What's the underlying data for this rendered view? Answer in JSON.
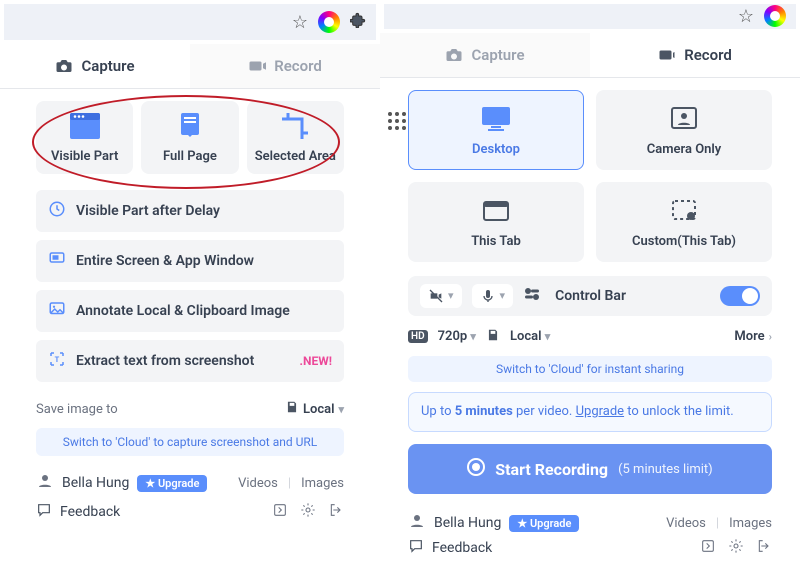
{
  "left": {
    "tabs": {
      "capture": "Capture",
      "record": "Record"
    },
    "cards": {
      "visible_part": "Visible Part",
      "full_page": "Full Page",
      "selected_area": "Selected Area"
    },
    "rows": {
      "delay": "Visible Part after Delay",
      "entire": "Entire Screen & App Window",
      "annotate": "Annotate Local & Clipboard Image",
      "extract": "Extract text from screenshot",
      "new_badge": ".NEW!"
    },
    "save_label": "Save image to",
    "save_target": "Local",
    "cloud_hint": "Switch to 'Cloud' to capture screenshot and URL",
    "user": {
      "name": "Bella Hung",
      "upgrade": "Upgrade",
      "videos": "Videos",
      "images": "Images"
    },
    "feedback": "Feedback"
  },
  "right": {
    "tabs": {
      "capture": "Capture",
      "record": "Record"
    },
    "cards": {
      "desktop": "Desktop",
      "camera": "Camera Only",
      "this_tab": "This Tab",
      "custom": "Custom(This Tab)"
    },
    "control_bar": "Control Bar",
    "res": {
      "quality": "720p",
      "dest": "Local",
      "more": "More"
    },
    "cloud_hint": "Switch to 'Cloud' for instant sharing",
    "limit": {
      "prefix": "Up to ",
      "bold": "5 minutes",
      "mid": " per video. ",
      "link": "Upgrade",
      "suffix": " to unlock the limit."
    },
    "start": {
      "label": "Start Recording",
      "sub": "(5 minutes limit)"
    },
    "user": {
      "name": "Bella Hung",
      "upgrade": "Upgrade",
      "videos": "Videos",
      "images": "Images"
    },
    "feedback": "Feedback",
    "hd": "HD"
  }
}
